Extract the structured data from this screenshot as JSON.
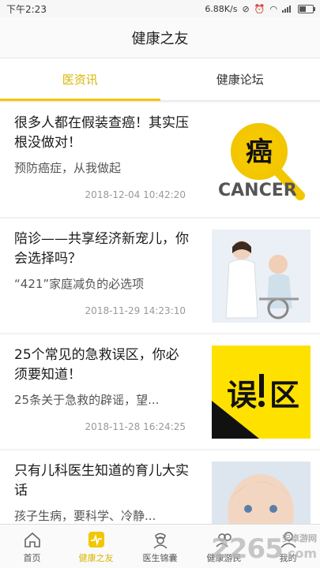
{
  "status": {
    "time": "下午2:23",
    "speed": "6.88K/s"
  },
  "header": {
    "title": "健康之友"
  },
  "tabs": [
    {
      "label": "医资讯"
    },
    {
      "label": "健康论坛"
    }
  ],
  "articles": [
    {
      "title": "很多人都在假装查癌！其实压根没做对！",
      "subtitle": "预防癌症，从我做起",
      "time": "2018-12-04 10:42:20",
      "image": {
        "char": "癌",
        "word": "CANCER"
      }
    },
    {
      "title": "陪诊——共享经济新宠儿，你会选择吗？",
      "subtitle": "“421”家庭减负的必选项",
      "time": "2018-11-29 14:23:10",
      "image": {}
    },
    {
      "title": "25个常见的急救误区，你必须要知道！",
      "subtitle": "25条关于急救的辟谣，望...",
      "time": "2018-11-28 16:24:25",
      "image": {
        "left_char": "误",
        "right_char": "区"
      }
    },
    {
      "title": "只有儿科医生知道的育儿大实话",
      "subtitle": "孩子生病，要科学、冷静...",
      "time": "",
      "image": {}
    }
  ],
  "nav": [
    {
      "label": "首页",
      "icon": "home-icon"
    },
    {
      "label": "健康之友",
      "icon": "pulse-icon"
    },
    {
      "label": "医生锦囊",
      "icon": "doctor-icon"
    },
    {
      "label": "健康游民",
      "icon": "people-icon"
    },
    {
      "label": "我的",
      "icon": "user-icon"
    }
  ],
  "watermark": {
    "number": "2265",
    "suffix": ".com",
    "site": "安卓游网"
  },
  "colors": {
    "accent": "#f2c600",
    "accent_text": "#d9b400"
  }
}
